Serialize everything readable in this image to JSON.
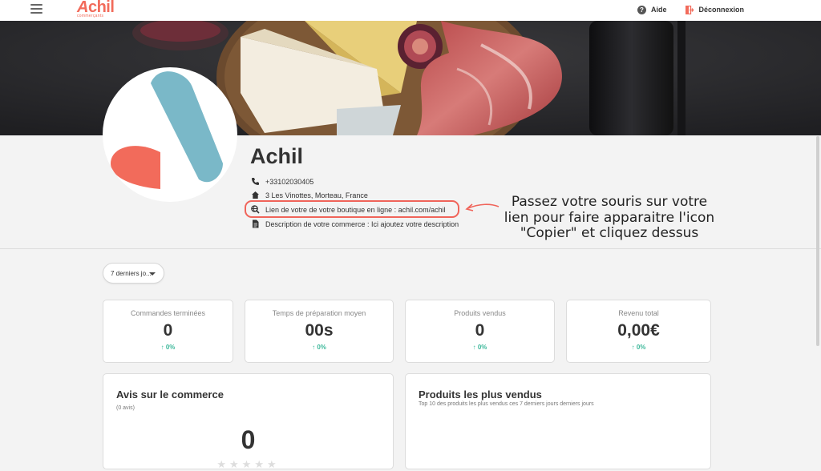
{
  "topbar": {
    "menu_icon": "hamburger-icon",
    "logo_text": "chil",
    "logo_subtitle": "commerçants",
    "help_label": "Aide",
    "logout_label": "Déconnexion"
  },
  "profile": {
    "name": "Achil",
    "phone": "+33102030405",
    "address": "3 Les Vinottes, Morteau, France",
    "link_text": "Lien de votre de votre boutique en ligne : achil.com/achil",
    "description": "Description de votre commerce : Ici ajoutez votre description"
  },
  "annotation": {
    "line1": "Passez votre souris sur votre",
    "line2": "lien pour faire apparaitre l'icon",
    "line3": "\"Copier\" et cliquez dessus"
  },
  "filter": {
    "selected": "7 derniers jo..."
  },
  "stats": [
    {
      "label": "Commandes terminées",
      "value": "0",
      "delta": "↑ 0%"
    },
    {
      "label": "Temps de préparation moyen",
      "value": "00s",
      "delta": "↑ 0%"
    },
    {
      "label": "Produits vendus",
      "value": "0",
      "delta": "↑ 0%"
    },
    {
      "label": "Revenu total",
      "value": "0,00€",
      "delta": "↑ 0%"
    }
  ],
  "reviews": {
    "title": "Avis sur le commerce",
    "count": "(0 avis)",
    "score": "0",
    "stars": "★★★★★"
  },
  "top_products": {
    "title": "Produits les plus vendus",
    "subtitle": "Top 10 des produits les plus vendus ces 7 derniers jours derniers jours"
  },
  "colors": {
    "accent": "#f26b5b",
    "logo_blue": "#7ab8c8",
    "positive": "#3cb89a"
  }
}
